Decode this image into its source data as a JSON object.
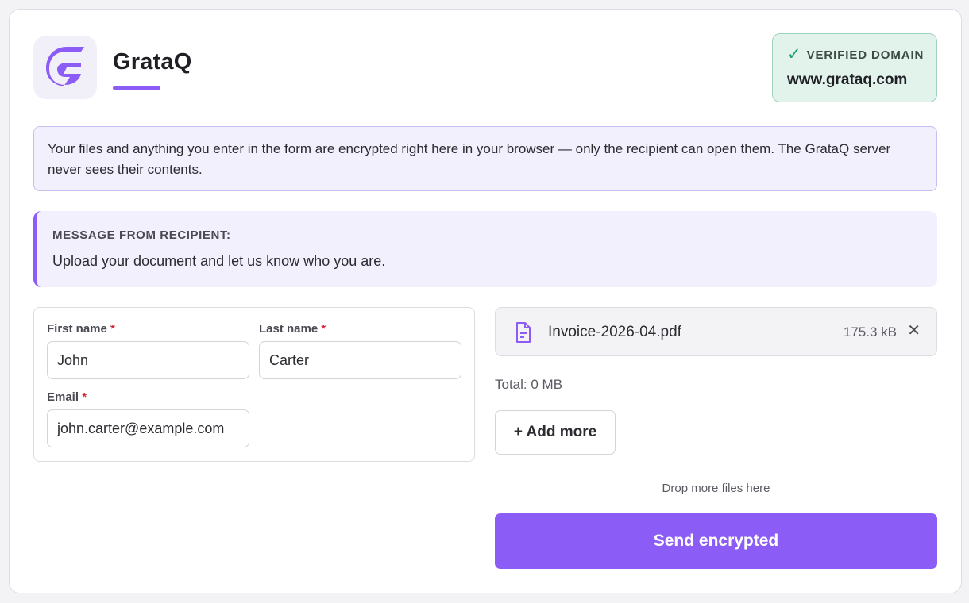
{
  "brand": {
    "name": "GrataQ",
    "logo_icon": "grataq-logo-icon",
    "accent_color": "#8b5cf6"
  },
  "verified": {
    "icon": "checkmark-icon",
    "label": "VERIFIED DOMAIN",
    "domain": "www.grataq.com"
  },
  "notice": {
    "text": "Your files and anything you enter in the form are encrypted right here in your browser — only the recipient can open them. The GrataQ server never sees their contents."
  },
  "message": {
    "heading": "MESSAGE FROM RECIPIENT:",
    "body": "Upload your document and let us know who you are."
  },
  "form": {
    "first_name": {
      "label": "First name",
      "required_mark": "*",
      "value": "John"
    },
    "last_name": {
      "label": "Last name",
      "required_mark": "*",
      "value": "Carter"
    },
    "email": {
      "label": "Email",
      "required_mark": "*",
      "value": "john.carter@example.com"
    }
  },
  "files": {
    "items": [
      {
        "icon": "document-icon",
        "name": "Invoice-2026-04.pdf",
        "size": "175.3 kB",
        "remove_icon": "close-icon",
        "remove_glyph": "✕"
      }
    ],
    "total": "Total: 0 MB",
    "add_more_label": "+ Add more",
    "drop_hint": "Drop more files here"
  },
  "actions": {
    "send_label": "Send encrypted"
  }
}
